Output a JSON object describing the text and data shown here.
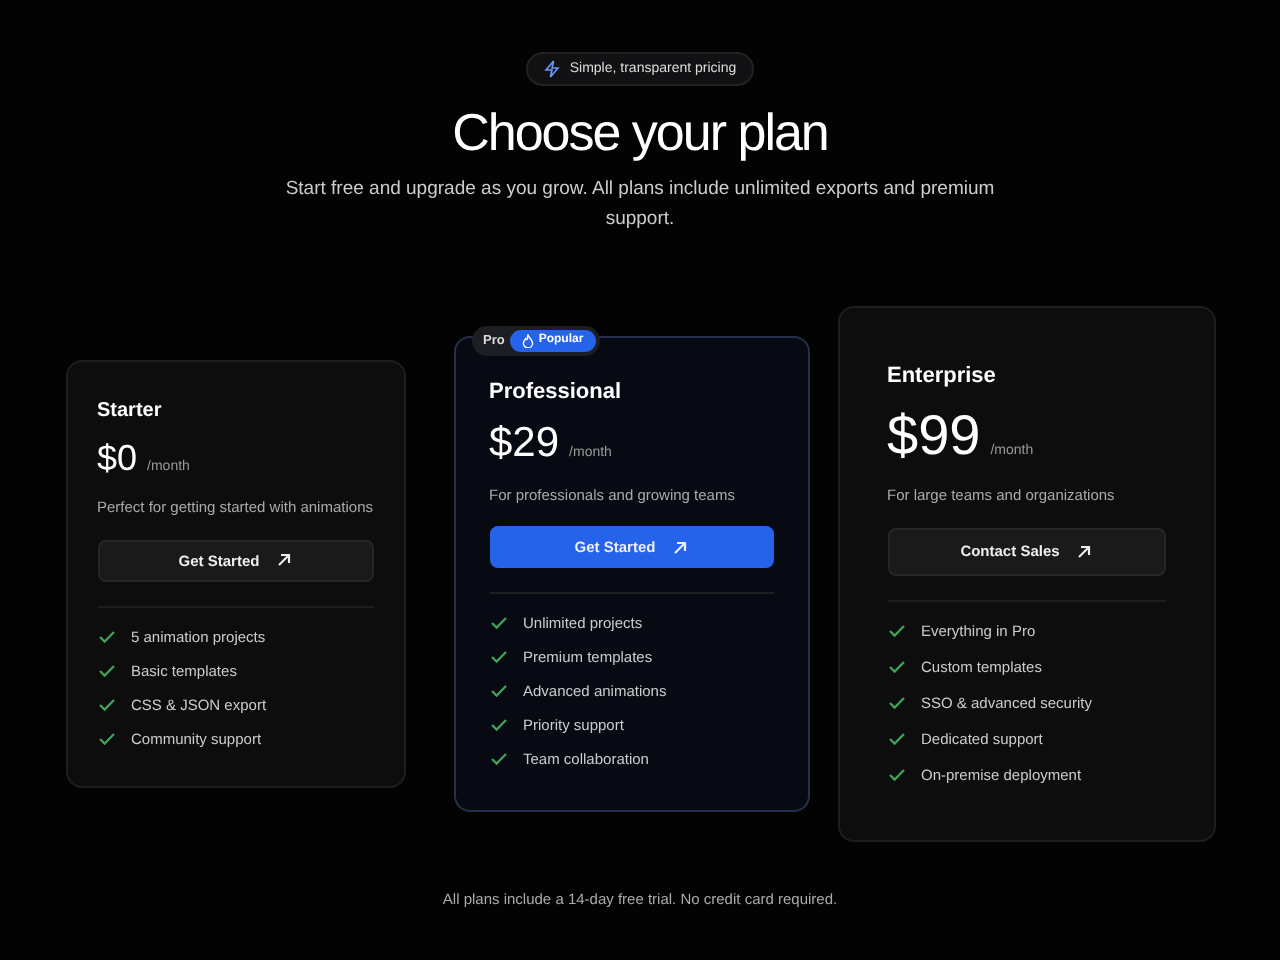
{
  "hero": {
    "badge": "Simple, transparent pricing",
    "title": "Choose your plan",
    "subtitle": "Start free and upgrade as you grow. All plans include unlimited exports and premium support."
  },
  "plans": [
    {
      "name": "Starter",
      "price": "$0",
      "period": "/month",
      "description": "Perfect for getting started with animations",
      "button": "Get Started",
      "featured": false,
      "features": [
        "5 animation projects",
        "Basic templates",
        "CSS & JSON export",
        "Community support"
      ]
    },
    {
      "name": "Professional",
      "price": "$29",
      "period": "/month",
      "description": "For professionals and growing teams",
      "button": "Get Started",
      "featured": true,
      "tag": "Pro",
      "badge": "Popular",
      "features": [
        "Unlimited projects",
        "Premium templates",
        "Advanced animations",
        "Priority support",
        "Team collaboration"
      ]
    },
    {
      "name": "Enterprise",
      "price": "$99",
      "period": "/month",
      "description": "For large teams and organizations",
      "button": "Contact Sales",
      "featured": false,
      "features": [
        "Everything in Pro",
        "Custom templates",
        "SSO & advanced security",
        "Dedicated support",
        "On-premise deployment"
      ]
    }
  ],
  "footnote": "All plans include a 14-day free trial. No credit card required."
}
